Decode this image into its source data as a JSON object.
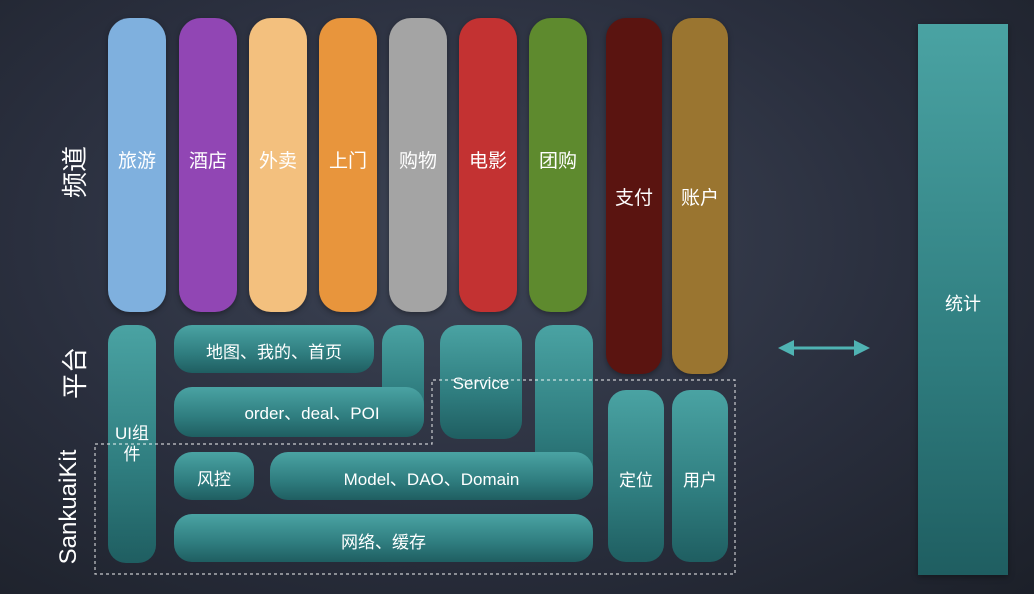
{
  "row_labels": {
    "channels": "频道",
    "platform": "平台",
    "kit": "SankuaiKit"
  },
  "channels": [
    {
      "label": "旅游",
      "color": "#7fb0de"
    },
    {
      "label": "酒店",
      "color": "#9146b4"
    },
    {
      "label": "外卖",
      "color": "#f3c07e"
    },
    {
      "label": "上门",
      "color": "#e8953c"
    },
    {
      "label": "购物",
      "color": "#a4a4a4"
    },
    {
      "label": "电影",
      "color": "#c33232"
    },
    {
      "label": "团购",
      "color": "#5e8a2e"
    }
  ],
  "finance": [
    {
      "label": "支付",
      "color": "#5a1410"
    },
    {
      "label": "账户",
      "color": "#9a7530"
    }
  ],
  "platform": {
    "ui_component": "UI组件",
    "pages": "地图、我的、首页",
    "entities": "order、deal、POI",
    "service": "Service",
    "risk": "风控",
    "model": "Model、DAO、Domain",
    "network": "网络、缓存",
    "location": "定位",
    "user": "用户"
  },
  "statistics": "统计",
  "colors": {
    "teal_top": "#4aa3a3",
    "teal_bottom": "#1f5e61",
    "arrow": "#4fb3b3"
  }
}
